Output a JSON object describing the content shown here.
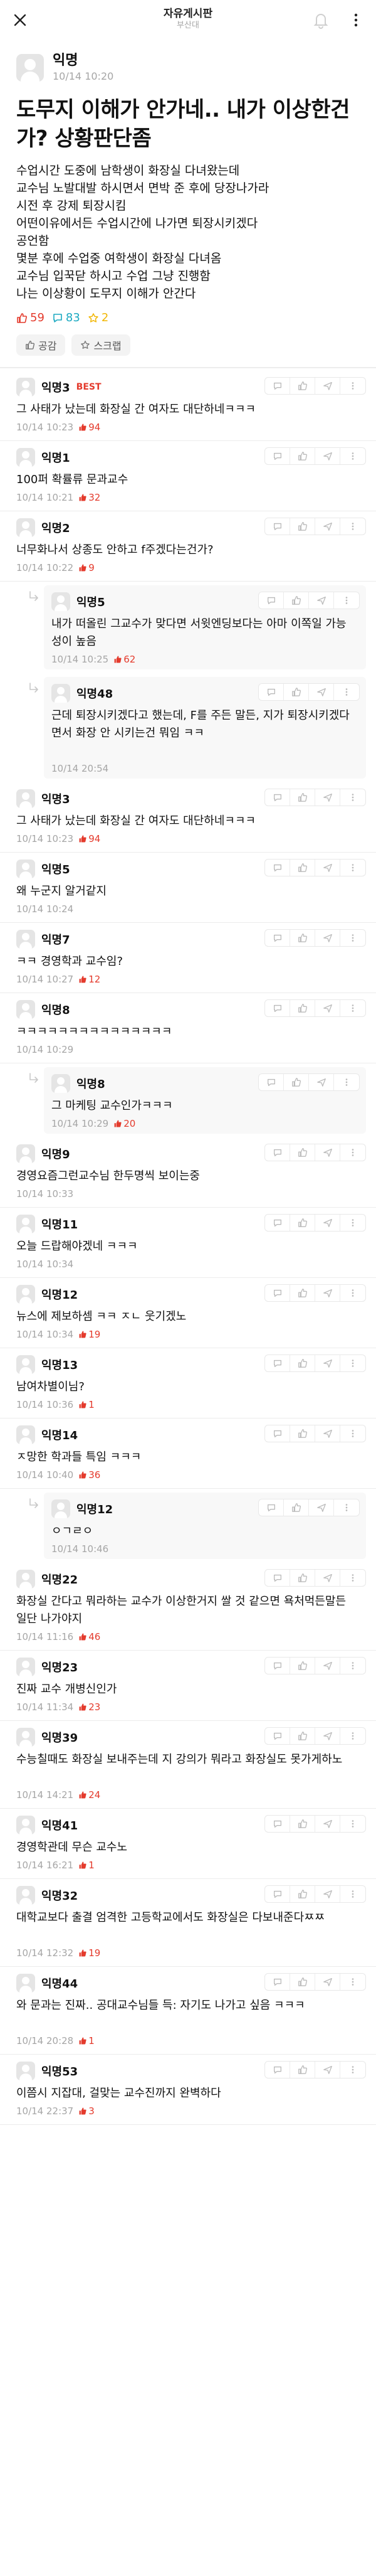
{
  "header": {
    "title": "자유게시판",
    "subtitle": "부산대"
  },
  "post": {
    "author": "익명",
    "time": "10/14 10:20",
    "title": "도무지 이해가 안가네.. 내가 이상한건가? 상황판단좀",
    "body": "수업시간 도중에 남학생이 화장실 다녀왔는데\n교수님 노발대발 하시면서 면박 준 후에 당장나가라\n시전 후 강제 퇴장시킴\n어떤이유에서든 수업시간에 나가면 퇴장시키겠다\n공언함\n몇분 후에 수업중 여학생이 화장실 다녀옴\n교수님 입꾹닫 하시고 수업 그냥 진행함\n나는 이상황이 도무지 이해가 안간다",
    "likes": "59",
    "comments": "83",
    "scraps": "2",
    "like_button": "공감",
    "scrap_button": "스크랩"
  },
  "colors": {
    "accent": "#e43b2d",
    "comment_count": "#1ba9c1",
    "scrap": "#f2b705",
    "meta": "#a6a6a6"
  },
  "comments": [
    {
      "type": "top",
      "name": "익명3",
      "best": "BEST",
      "text": "그 사태가 났는데 화장실 간 여자도 대단하네ㅋㅋㅋ",
      "time": "10/14 10:23",
      "likes": "94"
    },
    {
      "type": "top",
      "name": "익명1",
      "text": "100퍼 확률류 문과교수",
      "time": "10/14 10:21",
      "likes": "32"
    },
    {
      "type": "top",
      "name": "익명2",
      "text": "너무화나서 상종도 안하고 f주겠다는건가?",
      "time": "10/14 10:22",
      "likes": "9"
    },
    {
      "type": "reply",
      "name": "익명5",
      "text": "내가 떠올린 그교수가 맞다면 서윗엔딩보다는 아마 이쪽일 가능성이 높음",
      "time": "10/14 10:25",
      "likes": "62"
    },
    {
      "type": "reply",
      "name": "익명48",
      "text": "근데 퇴장시키겠다고 했는데, F를 주든 말든, 지가 퇴장시키겠다면서 화장 안 시키는건 뭐임 ㅋㅋ",
      "time": "10/14 20:54",
      "likes": ""
    },
    {
      "type": "top",
      "name": "익명3",
      "text": "그 사태가 났는데 화장실 간 여자도 대단하네ㅋㅋㅋ",
      "time": "10/14 10:23",
      "likes": "94"
    },
    {
      "type": "top",
      "name": "익명5",
      "text": "왜 누군지 알거같지",
      "time": "10/14 10:24",
      "likes": ""
    },
    {
      "type": "top",
      "name": "익명7",
      "text": "ㅋㅋ 경영학과 교수임?",
      "time": "10/14 10:27",
      "likes": "12"
    },
    {
      "type": "top",
      "name": "익명8",
      "text": "ㅋㅋㅋㅋㅋㅋㅋㅋㅋㅋㅋㅋㅋㅋㅋ",
      "time": "10/14 10:29",
      "likes": ""
    },
    {
      "type": "reply",
      "name": "익명8",
      "text": "그 마케팅 교수인가ㅋㅋㅋ",
      "time": "10/14 10:29",
      "likes": "20"
    },
    {
      "type": "top",
      "name": "익명9",
      "text": "경영요즘그런교수님 한두명씩 보이는중",
      "time": "10/14 10:33",
      "likes": ""
    },
    {
      "type": "top",
      "name": "익명11",
      "text": "오늘 드랍해야겠네 ㅋㅋㅋ",
      "time": "10/14 10:34",
      "likes": ""
    },
    {
      "type": "top",
      "name": "익명12",
      "text": "뉴스에 제보하셈 ㅋㅋ ㅈㄴ 웃기겠노",
      "time": "10/14 10:34",
      "likes": "19"
    },
    {
      "type": "top",
      "name": "익명13",
      "text": "남여차별이님?",
      "time": "10/14 10:36",
      "likes": "1"
    },
    {
      "type": "top",
      "name": "익명14",
      "text": "ㅈ망한 학과들 특임 ㅋㅋㅋ",
      "time": "10/14 10:40",
      "likes": "36"
    },
    {
      "type": "reply",
      "name": "익명12",
      "text": "ㅇㄱㄹㅇ",
      "time": "10/14 10:46",
      "likes": ""
    },
    {
      "type": "top",
      "name": "익명22",
      "text": "화장실 간다고 뭐라하는 교수가 이상한거지 쌀 것 같으면 욕처먹든말든 일단 나가야지",
      "time": "10/14 11:16",
      "likes": "46"
    },
    {
      "type": "top",
      "name": "익명23",
      "text": "진짜 교수 개병신인가",
      "time": "10/14 11:34",
      "likes": "23"
    },
    {
      "type": "top",
      "name": "익명39",
      "text": "수능칠때도 화장실 보내주는데 지 강의가 뭐라고 화장실도 못가게하노",
      "time": "10/14 14:21",
      "likes": "24"
    },
    {
      "type": "top",
      "name": "익명41",
      "text": "경영학관데 무슨 교수노",
      "time": "10/14 16:21",
      "likes": "1"
    },
    {
      "type": "top",
      "name": "익명32",
      "text": "대학교보다 출결 엄격한 고등학교에서도 화장실은 다보내준다ㅉㅉ",
      "time": "10/14 12:32",
      "likes": "19"
    },
    {
      "type": "top",
      "name": "익명44",
      "text": "와 문과는 진짜.. 공대교수님들 득: 자기도 나가고 싶음 ㅋㅋㅋ",
      "time": "10/14 20:28",
      "likes": "1"
    },
    {
      "type": "top",
      "name": "익명53",
      "text": "이쯤시 지잡대, 걸맞는 교수진까지 완벽하다",
      "time": "10/14 22:37",
      "likes": "3"
    }
  ]
}
